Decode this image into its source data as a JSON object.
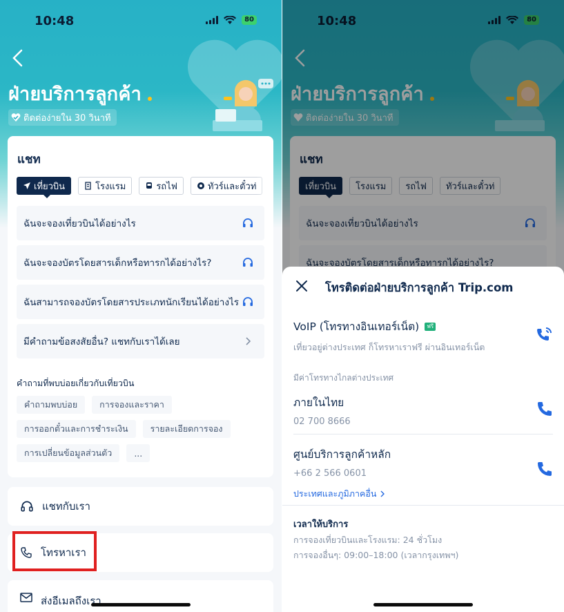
{
  "status_bar": {
    "time": "10:48",
    "battery": "80"
  },
  "header": {
    "title": "ฝ่ายบริการลูกค้า",
    "subtitle": "ติดต่อง่ายใน 30 วินาที"
  },
  "chat": {
    "heading": "แชท",
    "tabs": [
      {
        "label": "เที่ยวบิน",
        "icon": "plane-icon"
      },
      {
        "label": "โรงแรม",
        "icon": "building-icon"
      },
      {
        "label": "รถไฟ",
        "icon": "train-icon"
      },
      {
        "label": "ทัวร์และตั๋วท่",
        "icon": "tour-icon"
      }
    ],
    "questions": [
      "ฉันจะจองเที่ยวบินได้อย่างไร",
      "ฉันจะจองบัตรโดยสารเด็กหรือทารกได้อย่างไร?",
      "ฉันสามารถจองบัตรโดยสารประเภทนักเรียนได้อย่างไร",
      "มีคำถามข้อสงสัยอื่น? แชทกับเราได้เลย"
    ],
    "faq_title": "คำถามที่พบบ่อยเกี่ยวกับเที่ยวบิน",
    "faq_chips": [
      [
        "คำถามพบบ่อย",
        "การจองและราคา"
      ],
      [
        "การออกตั๋วและการชำระเงิน",
        "รายละเอียดการจอง"
      ],
      [
        "การเปลี่ยนข้อมูลส่วนตัว",
        "..."
      ]
    ]
  },
  "actions": {
    "chat": "แชทกับเรา",
    "call": "โทรหาเรา",
    "email": "ส่งอีเมลถึงเรา"
  },
  "call_sheet": {
    "title": "โทรติดต่อฝ่ายบริการลูกค้า Trip.com",
    "voip_title": "VoIP (โทรทางอินเทอร์เน็ต)",
    "voip_badge": "ฟรี",
    "voip_desc": "เที่ยวอยู่ต่างประเทศ ก็โทรหาเราฟรี ผ่านอินเทอร์เน็ต",
    "intl_note": "มีค่าโทรทางไกลต่างประเทศ",
    "contacts": [
      {
        "name": "ภายในไทย",
        "number": "02 700 8666"
      },
      {
        "name": "ศูนย์บริการลูกค้าหลัก",
        "number": "+66 2 566 0601"
      }
    ],
    "other_regions": "ประเทศและภูมิภาคอื่น",
    "hours_title": "เวลาให้บริการ",
    "hours_lines": [
      "การจองเที่ยวบินและโรงแรม: 24 ชั่วโมง",
      "การจองอื่นๆ: 09:00–18:00 (เวลากรุงเทพฯ)"
    ]
  },
  "colors": {
    "teal": "#27b1c6",
    "navy": "#0f294d",
    "link": "#2469e0",
    "phone_icon": "#2469e0",
    "highlight": "#e02020"
  }
}
